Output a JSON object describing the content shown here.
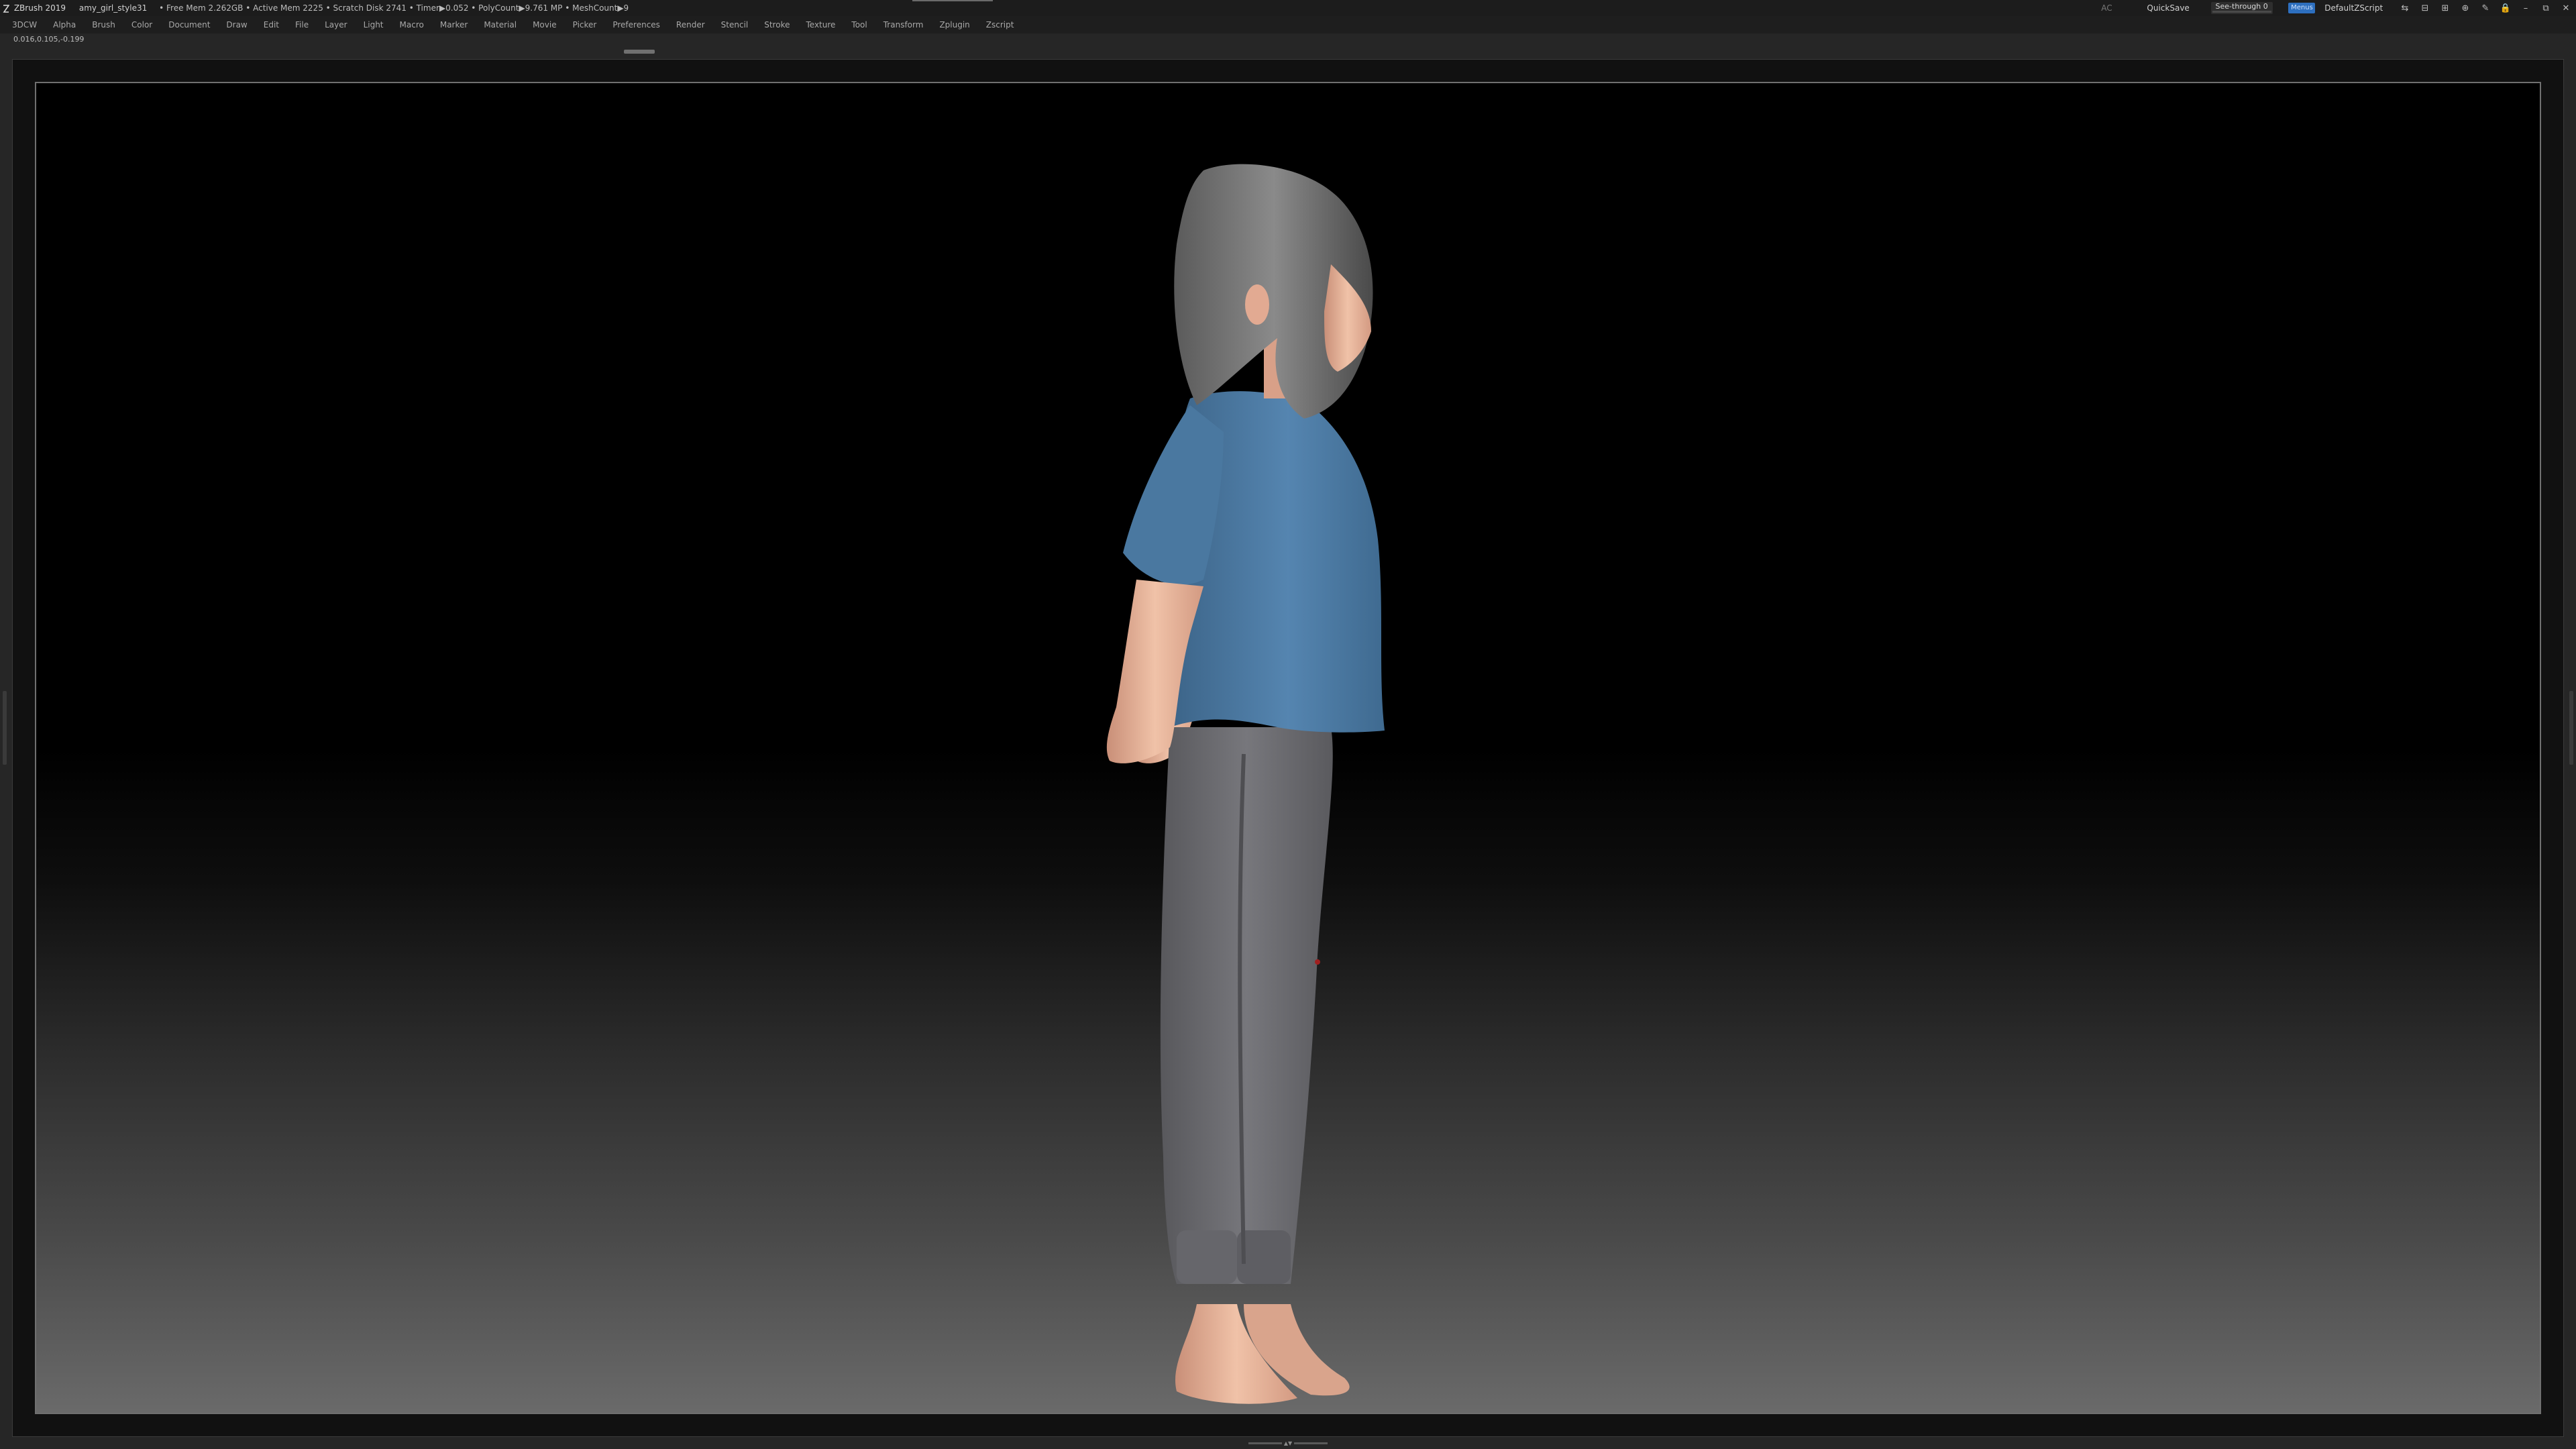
{
  "titlebar": {
    "app_name": "ZBrush 2019",
    "document_name": "amy_girl_style31",
    "stats": "• Free Mem 2.262GB • Active Mem 2225 • Scratch Disk 2741 • Timer▶0.052 • PolyCount▶9.761 MP • MeshCount▶9",
    "ac_label": "AC",
    "quicksave_label": "QuickSave",
    "see_through_label": "See-through",
    "see_through_value": "0",
    "see_through_level": 0,
    "menus_label": "Menus",
    "default_script_label": "DefaultZScript",
    "window_icons": [
      "⇆",
      "⊟",
      "⊞",
      "⊕",
      "✎",
      "🔒",
      "–",
      "⧉",
      "✕"
    ]
  },
  "menubar": {
    "items": [
      "3DCW",
      "Alpha",
      "Brush",
      "Color",
      "Document",
      "Draw",
      "Edit",
      "File",
      "Layer",
      "Light",
      "Macro",
      "Marker",
      "Material",
      "Movie",
      "Picker",
      "Preferences",
      "Render",
      "Stencil",
      "Stroke",
      "Texture",
      "Tool",
      "Transform",
      "Zplugin",
      "Zscript"
    ]
  },
  "status": {
    "coordinates": "0.016,0.105,-0.199"
  },
  "colors": {
    "shirt": "#4f7ea8",
    "pants": "#6e6e73",
    "hair": "#7a7a7a",
    "skin": "#e8b49a",
    "accent": "#2d6fbf"
  },
  "icons": {
    "logo": "zbrush-logo-icon",
    "collapse_handle": "drag-handle-icon"
  }
}
